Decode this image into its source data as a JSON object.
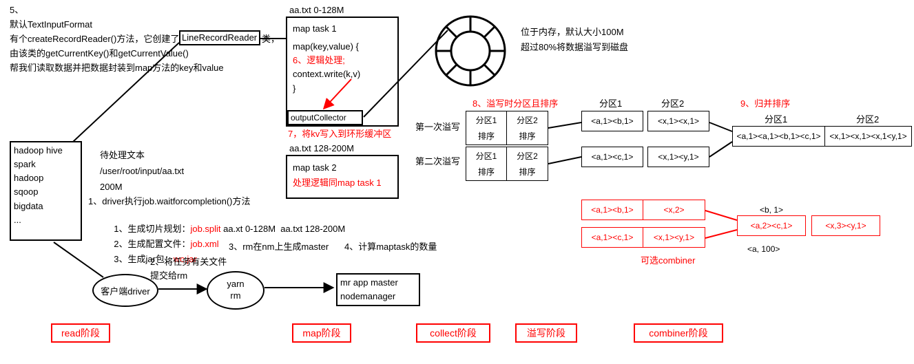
{
  "tl": {
    "l1": "5、",
    "l2": "默认TextInputFormat",
    "l3_a": "有个createRecordReader()方法，它创建了",
    "l3_b": "LineRecordReader",
    "l3_c": "类，",
    "l4": "由该类的getCurrentKey()和getCurrentValue()",
    "l5": "帮我们读取数据并把数据封装到map方法的key和value"
  },
  "dataBox": {
    "l1": "hadoop hive",
    "l2": "spark",
    "l3": "hadoop",
    "l4": "sqoop",
    "l5": "bigdata",
    "l6": "..."
  },
  "mid": {
    "l1": "待处理文本",
    "l2": "/user/root/input/aa.txt",
    "l3": "200M",
    "l4": "1、driver执行job.waitforcompletion()方法",
    "l5_a": "1、生成切片规划：",
    "l5_b": "job.split",
    "l5_c": " aa.xt 0-128M  aa.txt 128-200M",
    "l6_a": "2、生成配置文件：",
    "l6_b": "job.xml",
    "l7_a": "3、生成jar包：",
    "l7_b": "wc.jar",
    "l8": "2、将任务有关文件",
    "l9": "提交给rm",
    "rm_label": "3、rm在nm上生成master",
    "maptask_count": "4、计算maptask的数量"
  },
  "driverOval": "客户端driver",
  "yarnOval": {
    "l1": "yarn",
    "l2": "rm"
  },
  "masterBox": {
    "l1": "mr app master",
    "l2": "nodemanager"
  },
  "mapTask1": {
    "title": "aa.txt 0-128M",
    "l1": "map task 1",
    "l2": "map(key,value)  {",
    "l3": "6、逻辑处理;",
    "l4": "context.write(k,v)",
    "l5": "}",
    "out": "outputCollector",
    "note": "7，将kv写入到环形缓冲区"
  },
  "mapTask2": {
    "title": "aa.txt 128-200M",
    "l1": "map task  2",
    "l2": "处理逻辑同map task 1"
  },
  "ring": {
    "l1": "位于内存，默认大小100M",
    "l2": "超过80%将数据溢写到磁盘"
  },
  "spill": {
    "title8": "8、溢写时分区且排序",
    "firstLabel": "第一次溢写",
    "secondLabel": "第二次溢写",
    "p1": "分区1",
    "p2": "分区2",
    "sort": "排序"
  },
  "partitions": {
    "p1": "分区1",
    "p2": "分区2",
    "r1c1": "<a,1><b,1>",
    "r1c2": "<x,1><x,1>",
    "r2c1": "<a,1><c,1>",
    "r2c2": "<x,1><y,1>"
  },
  "merge": {
    "title9": "9、归并排序",
    "p1": "分区1",
    "p2": "分区2",
    "c1": "<a,1><a,1><b,1><c,1>",
    "c2": "<x,1><x,1><x,1<y,1>"
  },
  "combiner": {
    "label": "可选combiner",
    "in_r1c1": "<a,1><b,1>",
    "in_r1c2": "<x,2>",
    "in_r2c1": "<a,1><c,1>",
    "in_r2c2": "<x,1><y,1>",
    "out_c1a": "<b, 1>",
    "out_c1b": "<a,2><c,1>",
    "out_c2": "<x,3><y,1>",
    "note": "<a, 100>"
  },
  "phases": {
    "read": "read阶段",
    "map": "map阶段",
    "collect": "collect阶段",
    "spill": "溢写阶段",
    "combiner": "combiner阶段"
  }
}
